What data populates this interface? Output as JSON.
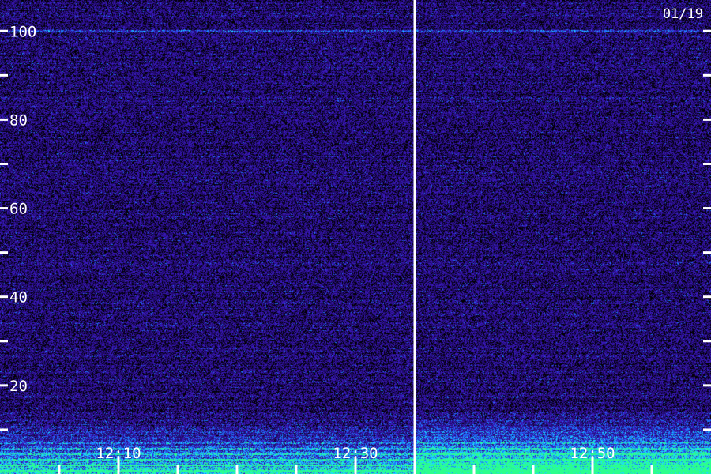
{
  "chart_data": {
    "type": "heatmap",
    "title": "",
    "date_label": "01/19",
    "xlabel": "",
    "ylabel": "",
    "y_ticks": [
      100,
      80,
      60,
      40,
      20
    ],
    "y_tick_labels": [
      "100",
      "80",
      "60",
      "40",
      "20"
    ],
    "y_minor_ticks": [
      90,
      70,
      50,
      30,
      10
    ],
    "ylim": [
      0,
      107
    ],
    "x_tick_labels": [
      "12:10",
      "12:30",
      "12:50"
    ],
    "x_labeled_times": [
      "12:10",
      "12:30",
      "12:50"
    ],
    "x_minor_ticks": [
      "12:05",
      "12:10",
      "12:15",
      "12:20",
      "12:25",
      "12:30",
      "12:35",
      "12:40",
      "12:45",
      "12:50",
      "12:55",
      "13:00"
    ],
    "xlim": [
      "12:00",
      "13:00"
    ],
    "marker_time": "12:35",
    "line_frequency": 100,
    "colormap": [
      "#000000",
      "#2a0a78",
      "#3c1cc8",
      "#1c78ff",
      "#1cdcff",
      "#2cff8c"
    ],
    "accent_color": "#ffffff",
    "grid": false
  }
}
